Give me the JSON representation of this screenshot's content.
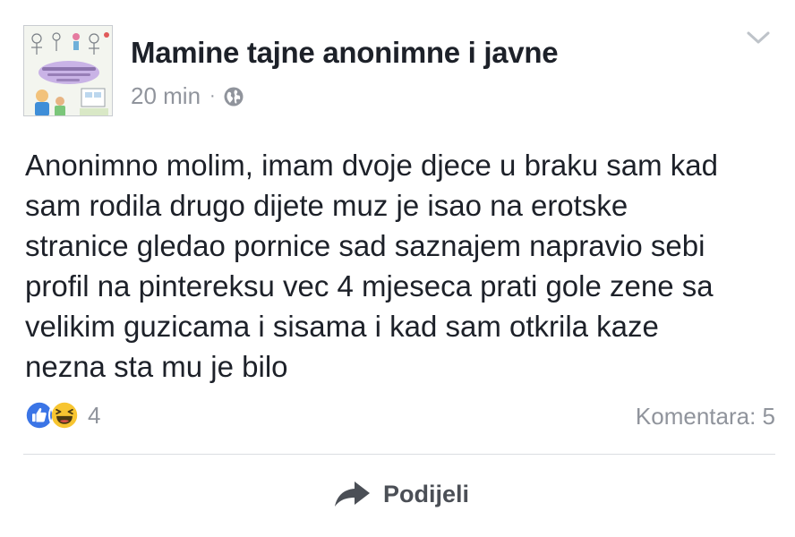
{
  "post": {
    "page_name": "Mamine tajne anonimne i javne",
    "timestamp": "20 min",
    "separator": "·",
    "privacy_icon": "globe-icon",
    "menu_icon": "chevron-down-icon",
    "avatar_text": "Mamine tajne anonimne i javne",
    "text_lines": [
      "Anonimno molim, imam dvoje djece u braku sam kad",
      "sam rodila drugo dijete muz je isao na erotske",
      "stranice gledao pornice sad saznajem napravio sebi",
      "profil na pintereksu vec 4 mjeseca prati gole zene sa",
      "velikim guzicama i sisama i kad sam otkrila kaze",
      "nezna sta mu je bilo"
    ]
  },
  "reactions": {
    "icons": [
      "like-icon",
      "haha-icon"
    ],
    "count": "4",
    "like_color": "#3b75e6",
    "haha_color": "#f7c531"
  },
  "comments": {
    "label": "Komentara: 5"
  },
  "actions": {
    "share_label": "Podijeli",
    "share_icon": "share-arrow-icon"
  }
}
